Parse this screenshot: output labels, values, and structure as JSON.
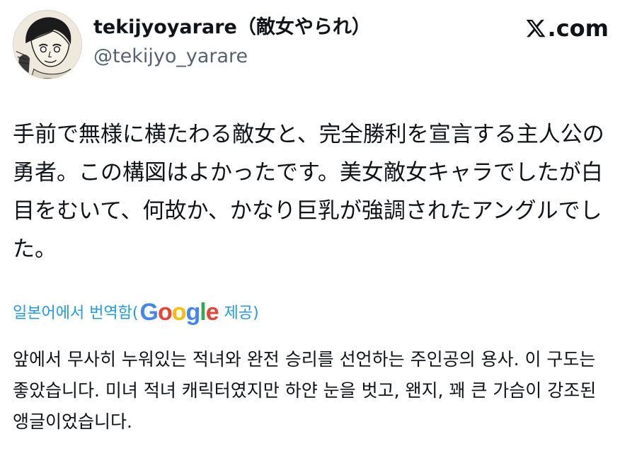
{
  "header": {
    "display_name": "tekijyoyarare（敵女やられ）",
    "handle": "@tekijyo_yarare",
    "brand_text": ".com",
    "brand_icon": "x-logo-icon"
  },
  "tweet": {
    "text": "手前で無様に横たわる敵女と、完全勝利を宣言する主人公の勇者。この構図はよかったです。美女敵女キャラでしたが白目をむいて、何故か、かなり巨乳が強調されたアングルでした。"
  },
  "translation": {
    "prefix": "일본어에서 번역함(",
    "provider_letters": [
      "G",
      "o",
      "o",
      "g",
      "l",
      "e"
    ],
    "provider_colors": [
      "#4285F4",
      "#EA4335",
      "#FBBC05",
      "#4285F4",
      "#34A853",
      "#EA4335"
    ],
    "suffix": " 제공)",
    "text": "앞에서 무사히 누워있는 적녀와 완전 승리를 선언하는 주인공의 용사. 이 구도는 좋았습니다. 미녀 적녀 캐릭터였지만 하얀 눈을 벗고, 왠지, 꽤 큰 가슴이 강조된 앵글이었습니다."
  },
  "colors": {
    "link": "#1d9bf0",
    "text": "#0f1419",
    "secondary": "#536471"
  }
}
